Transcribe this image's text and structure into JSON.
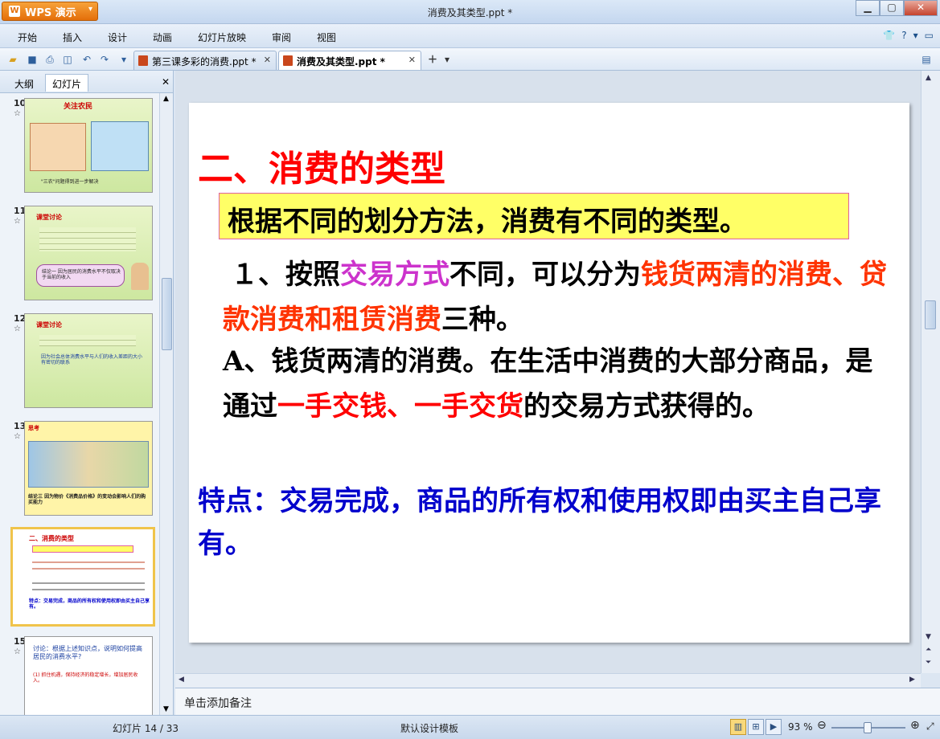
{
  "app": {
    "brand_label": "WPS 演示",
    "window_title": "消费及其类型.ppt *"
  },
  "menu": [
    "开始",
    "插入",
    "设计",
    "动画",
    "幻灯片放映",
    "审阅",
    "视图"
  ],
  "tabs": [
    {
      "label": "第三课多彩的消费.ppt *"
    },
    {
      "label": "消费及其类型.ppt *"
    }
  ],
  "left_pane": {
    "tab_outline": "大纲",
    "tab_slides": "幻灯片",
    "slides": [
      {
        "num": "10",
        "title": "关注农民",
        "caption": "\"三农\"问题得到进一步解决"
      },
      {
        "num": "11",
        "title": "课堂讨论",
        "caption": "结论一 因为居民的消费水平不仅取决于当前的收入"
      },
      {
        "num": "12",
        "title": "课堂讨论",
        "caption": "因为社会总体消费水平与人们的收入差距的大小有密切的联系"
      },
      {
        "num": "13",
        "title": "思考",
        "caption": "结论三 因为物价《消费品价格》的变动会影响人们的购买能力"
      },
      {
        "num": "14",
        "title": "二、消费的类型",
        "caption": "特点：交易完成，商品的所有权和使用权即由买主自己享有。"
      },
      {
        "num": "15",
        "title": "讨论：根据上述知识点，说明如何提高居民的消费水平?",
        "caption": "(1) 抓住机遇，保持经济的稳定增长，增加居民收入。"
      }
    ]
  },
  "slide": {
    "title": "二、消费的类型",
    "box_text": "根据不同的划分方法，消费有不同的类型。",
    "p1_a": "１、按照",
    "p1_b": "交易方式",
    "p1_c": "不同，可以分为",
    "p1_d": "钱货两清的消费、贷款消费和租赁消费",
    "p1_e": "三种。",
    "p2_a": "A、钱货两清的消费。在生活中消费的大部分商品，是通过",
    "p2_b": "一手交钱、一手交货",
    "p2_c": "的交易方式获得的。",
    "p3": "特点：交易完成，商品的所有权和使用权即由买主自己享有。"
  },
  "notes_placeholder": "单击添加备注",
  "status": {
    "slide_counter": "幻灯片 14 / 33",
    "template": "默认设计模板",
    "zoom": "93 %"
  },
  "colors": {
    "title_red": "#ff0000",
    "highlight_yellow": "#ffff66",
    "purple": "#cc33cc",
    "orange": "#ff3300",
    "blue": "#0000cc"
  }
}
